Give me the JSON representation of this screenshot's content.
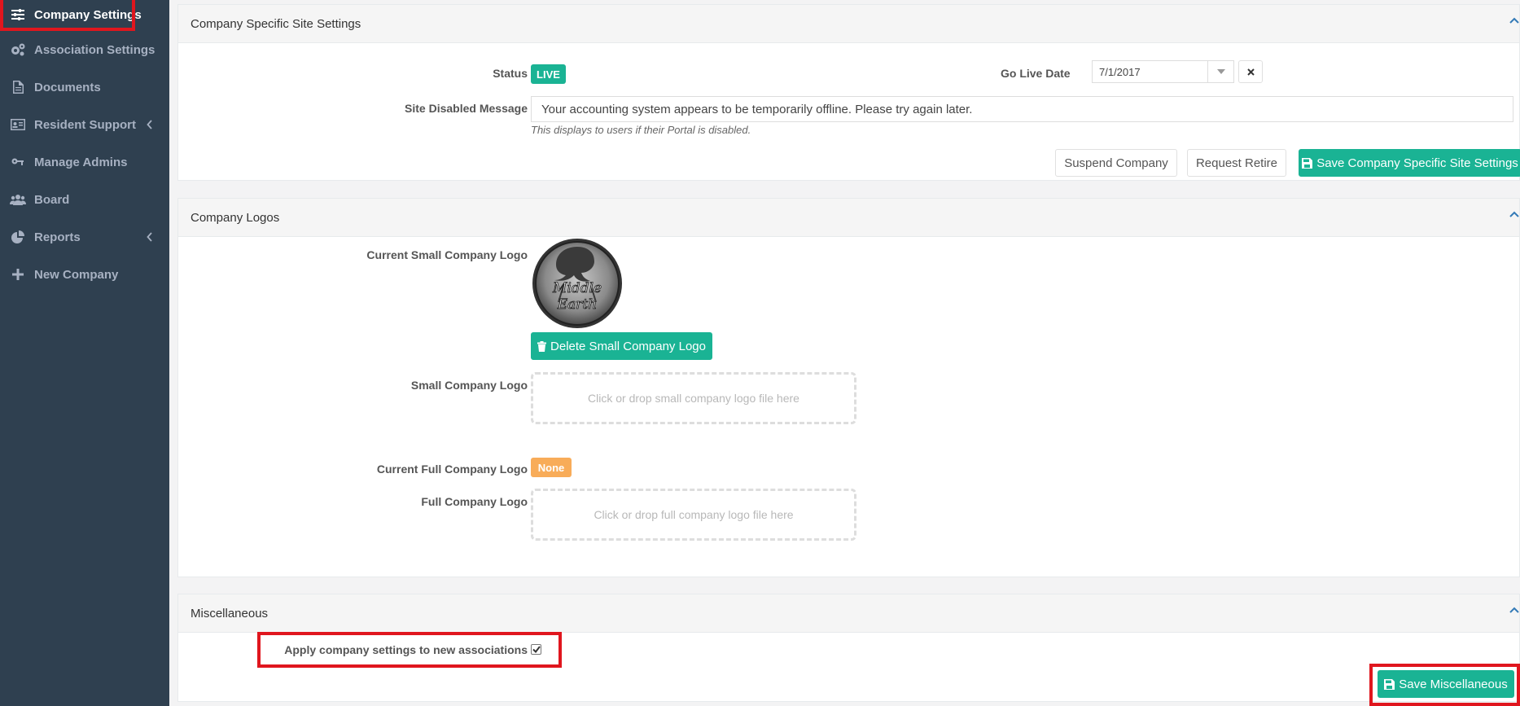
{
  "sidebar": {
    "items": [
      {
        "label": "Company Settings",
        "icon": "sliders-icon"
      },
      {
        "label": "Association Settings",
        "icon": "gears-icon"
      },
      {
        "label": "Documents",
        "icon": "document-icon"
      },
      {
        "label": "Resident Support",
        "icon": "id-card-icon"
      },
      {
        "label": "Manage Admins",
        "icon": "key-icon"
      },
      {
        "label": "Board",
        "icon": "users-icon"
      },
      {
        "label": "Reports",
        "icon": "pie-chart-icon"
      },
      {
        "label": "New Company",
        "icon": "plus-icon"
      }
    ]
  },
  "site_settings": {
    "title": "Company Specific Site Settings",
    "status_label": "Status",
    "status_value": "LIVE",
    "go_live_label": "Go Live Date",
    "go_live_value": "7/1/2017",
    "disabled_msg_label": "Site Disabled Message",
    "disabled_msg_value": "Your accounting system appears to be temporarily offline. Please try again later.",
    "disabled_msg_help": "This displays to users if their Portal is disabled.",
    "suspend_label": "Suspend Company",
    "retire_label": "Request Retire",
    "save_label": "Save Company Specific Site Settings"
  },
  "logos": {
    "title": "Company Logos",
    "current_small_label": "Current Small Company Logo",
    "logo_text_line1": "Middle",
    "logo_text_line2": "Earth",
    "delete_small_label": "Delete Small Company Logo",
    "small_label": "Small Company Logo",
    "small_drop_text": "Click or drop small company logo file here",
    "current_full_label": "Current Full Company Logo",
    "current_full_value": "None",
    "full_label": "Full Company Logo",
    "full_drop_text": "Click or drop full company logo file here"
  },
  "misc": {
    "title": "Miscellaneous",
    "apply_label": "Apply company settings to new associations",
    "apply_checked": true,
    "save_label": "Save Miscellaneous"
  },
  "colors": {
    "sidebar_bg": "#2f4050",
    "accent_green": "#1ab394",
    "warning_orange": "#f8ac59",
    "highlight_red": "#e0161e"
  }
}
